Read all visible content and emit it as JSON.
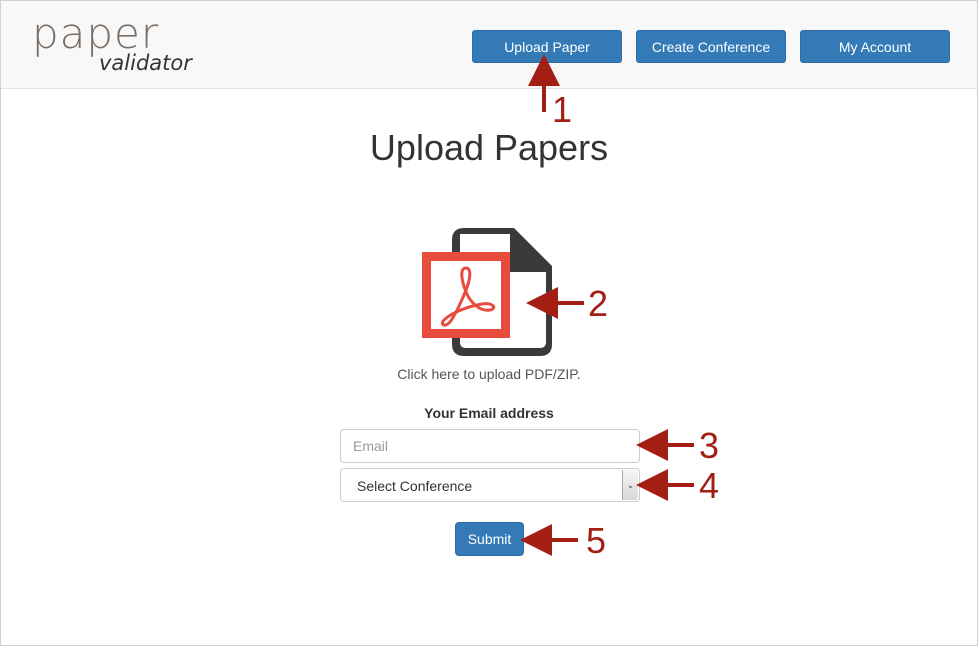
{
  "logo": {
    "main": "paper",
    "sub": "validator"
  },
  "nav": {
    "upload_paper": "Upload Paper",
    "create_conference": "Create Conference",
    "my_account": "My Account"
  },
  "page_title": "Upload Papers",
  "upload": {
    "icon": "pdf-file-icon",
    "caption": "Click here to upload PDF/ZIP."
  },
  "form": {
    "email_label": "Your Email address",
    "email_placeholder": "Email",
    "email_value": "",
    "conference_selected": "Select Conference",
    "submit_label": "Submit"
  },
  "annotations": {
    "labels": [
      "1",
      "2",
      "3",
      "4",
      "5"
    ],
    "color": "#a31f14"
  },
  "colors": {
    "primary": "#337ab7",
    "pdf_red": "#e74c3c",
    "file_dark": "#3a3a3a"
  }
}
